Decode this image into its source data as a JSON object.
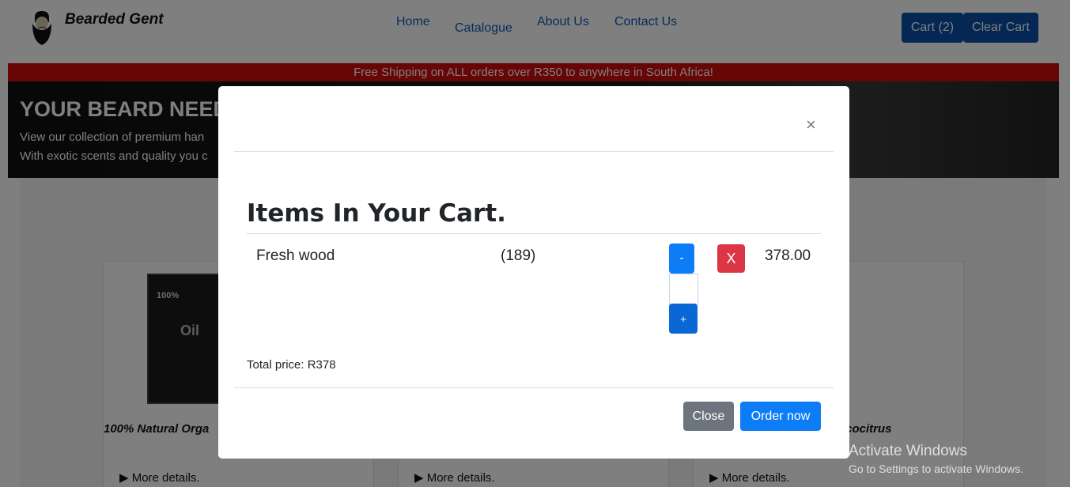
{
  "nav": {
    "brand": "Bearded Gent",
    "links": [
      "Home",
      "Catalogue",
      "About Us",
      "Contact Us"
    ],
    "cart_label": "Cart (2)",
    "clear_cart_label": "Clear Cart"
  },
  "banner": {
    "shipping_text": "Free Shipping on ALL orders over R350 to anywhere in South Africa!"
  },
  "hero": {
    "title": "YOUR BEARD NEED",
    "line1": "View our collection of premium han",
    "line2": "With exotic scents and quality you c"
  },
  "products": [
    {
      "title": "100% Natural Orga",
      "more": "More details."
    },
    {
      "title": "",
      "more": "More details."
    },
    {
      "title": "ococitrus",
      "more": "More details."
    }
  ],
  "modal": {
    "close_symbol": "×",
    "heading": "Items In Your Cart.",
    "items": [
      {
        "name": "Fresh wood",
        "qty": "(189)",
        "minus": "-",
        "plus": "+",
        "remove": "X",
        "price": "378.00"
      }
    ],
    "total": "Total price: R378",
    "close_button": "Close",
    "order_button": "Order now"
  },
  "watermark": {
    "title": "Activate Windows",
    "subtitle": "Go to Settings to activate Windows."
  },
  "colors": {
    "primary": "#0d7cf7",
    "danger": "#dc3545",
    "secondary": "#6c757d",
    "banner_red": "#d10a0a",
    "nav_button": "#0b4fa8"
  }
}
